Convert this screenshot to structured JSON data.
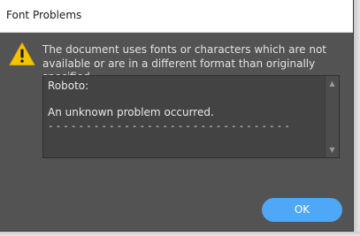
{
  "window": {
    "title": "Font Problems"
  },
  "alert": {
    "icon": "warning-icon",
    "message": "The document uses fonts or characters which are not available or are in a different format than originally specified."
  },
  "details": {
    "font_name": "Roboto:",
    "problem": "An unknown problem occurred.",
    "separator": "--------------------------------",
    "scroll_up_icon": "▲",
    "scroll_down_icon": "▼"
  },
  "buttons": {
    "ok_label": "OK"
  },
  "colors": {
    "dialog_bg": "#535353",
    "titlebar_bg": "#ffffff",
    "accent_button": "#4ea7f7",
    "warning_yellow": "#f5c400"
  }
}
